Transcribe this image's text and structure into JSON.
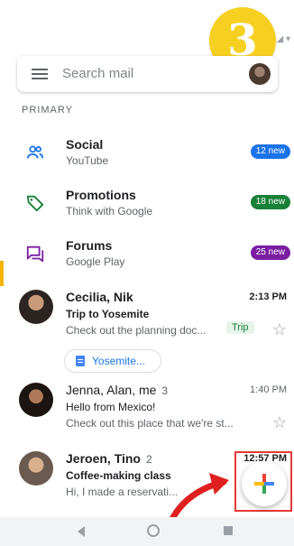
{
  "step_badge": "3",
  "search": {
    "placeholder": "Search mail"
  },
  "section_label": "PRIMARY",
  "categories": [
    {
      "title": "Social",
      "sub": "YouTube",
      "badge": "12 new",
      "color": "#1a73e8",
      "icon": "people-icon"
    },
    {
      "title": "Promotions",
      "sub": "Think with Google",
      "badge": "18 new",
      "color": "#188038",
      "icon": "tag-icon"
    },
    {
      "title": "Forums",
      "sub": "Google Play",
      "badge": "25 new",
      "color": "#7b1fa2",
      "icon": "forum-icon"
    }
  ],
  "emails": [
    {
      "from": "Cecilia, Nik",
      "count": "",
      "time": "2:13 PM",
      "subject": "Trip to Yosemite",
      "preview": "Check out the planning doc...",
      "label": "Trip",
      "attachment": "Yosemite...",
      "unread": true
    },
    {
      "from": "Jenna, Alan, me",
      "count": "3",
      "time": "1:40 PM",
      "subject": "Hello from Mexico!",
      "preview": "Check out this place that we're st...",
      "unread": false
    },
    {
      "from": "Jeroen, Tino",
      "count": "2",
      "time": "12:57 PM",
      "subject": "Coffee-making class",
      "preview": "Hi, I made a reservati...",
      "unread": true
    }
  ]
}
